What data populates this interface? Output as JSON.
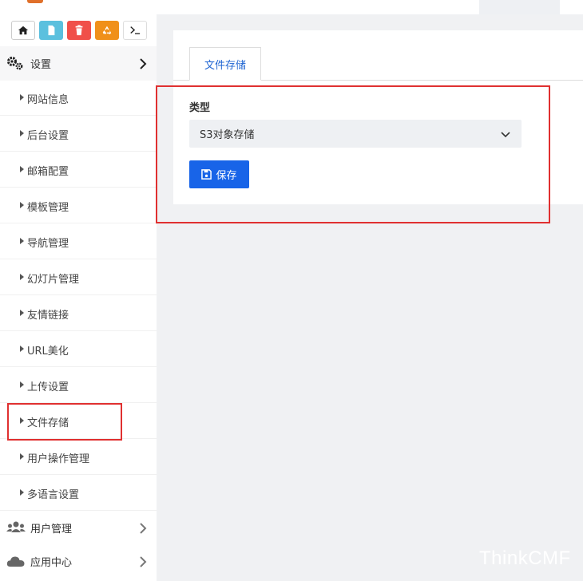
{
  "sidebar": {
    "settings_label": "设置",
    "items": [
      {
        "label": "网站信息"
      },
      {
        "label": "后台设置"
      },
      {
        "label": "邮箱配置"
      },
      {
        "label": "模板管理"
      },
      {
        "label": "导航管理"
      },
      {
        "label": "幻灯片管理"
      },
      {
        "label": "友情链接"
      },
      {
        "label": "URL美化"
      },
      {
        "label": "上传设置"
      },
      {
        "label": "文件存储"
      },
      {
        "label": "用户操作管理"
      },
      {
        "label": "多语言设置"
      }
    ],
    "user_mgmt_label": "用户管理",
    "app_center_label": "应用中心"
  },
  "content": {
    "tab_label": "文件存储",
    "type_label": "类型",
    "select_value": "S3对象存储",
    "save_label": "保存"
  },
  "watermark": "ThinkCMF",
  "colors": {
    "primary": "#1864e8",
    "highlight": "#e03030",
    "background": "#f0f1f3"
  }
}
